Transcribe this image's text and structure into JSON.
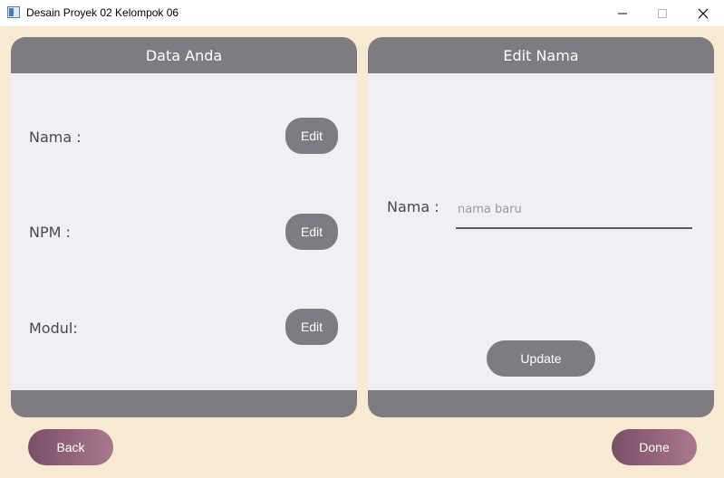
{
  "window": {
    "title": "Desain Proyek 02 Kelompok 06",
    "icons": {
      "app": "app-window-icon",
      "minimize": "minimize-icon",
      "maximize": "maximize-icon",
      "close": "close-icon"
    }
  },
  "left_panel": {
    "header": "Data Anda",
    "fields": [
      {
        "label": "Nama :",
        "button": "Edit"
      },
      {
        "label": "NPM :",
        "button": "Edit"
      },
      {
        "label": "Modul:",
        "button": "Edit"
      }
    ]
  },
  "right_panel": {
    "header": "Edit Nama",
    "name_label": "Nama :",
    "name_input": {
      "value": "",
      "placeholder": "nama baru"
    },
    "update_button": "Update"
  },
  "footer": {
    "back_button": "Back",
    "done_button": "Done"
  },
  "colors": {
    "background": "#f8ead2",
    "panel": "#f1eff4",
    "panel_header": "#7f7b82",
    "nav_gradient_start": "#7a4f66",
    "nav_gradient_end": "#a9788e"
  }
}
